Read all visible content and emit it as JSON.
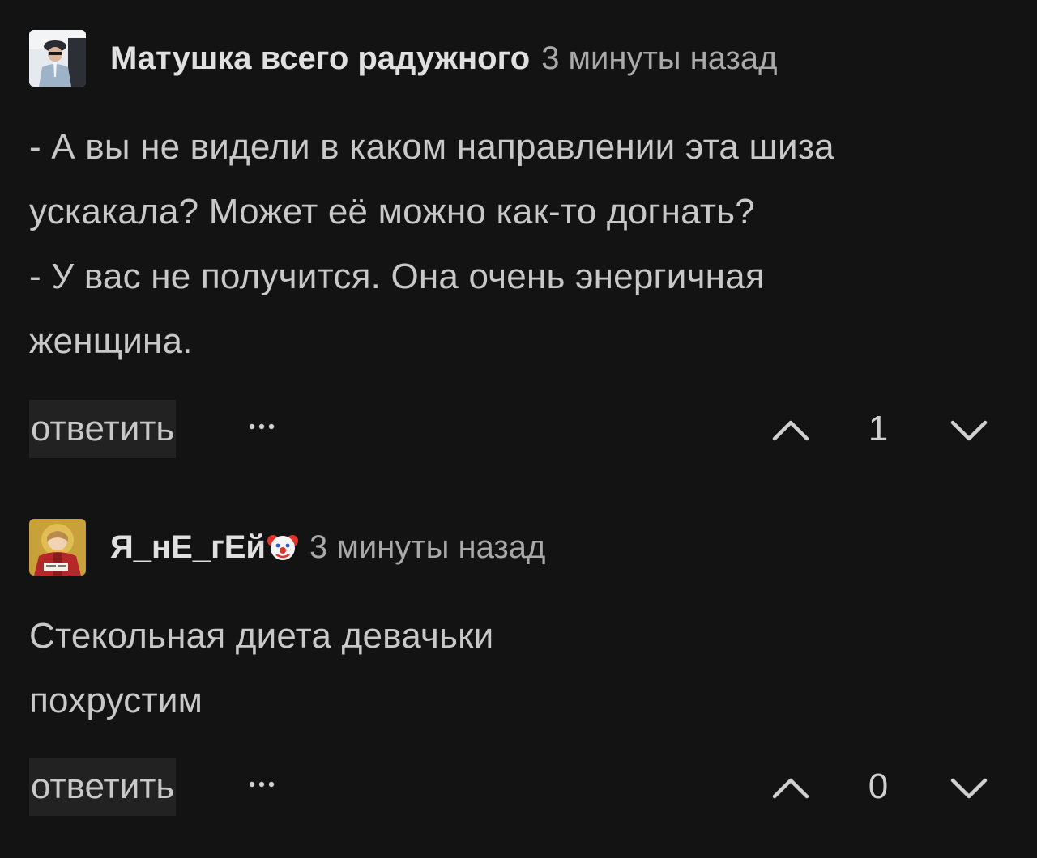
{
  "comments": [
    {
      "author": "Матушка всего радужного",
      "time": "3 минуты назад",
      "text": "- А вы не видели в каком направлении эта шиза\nускакала? Может её можно как-то догнать?\n- У вас не получится. Она очень энергичная\nженщина.",
      "reply_label": "ответить",
      "score": "1",
      "avatar_icon": "user-photo-avatar"
    },
    {
      "author": "Я_нЕ_гЕй",
      "author_badge_icon": "clown-face-emoji",
      "time": "3 минуты назад",
      "text": "Стекольная диета девачьки\nпохрустим",
      "reply_label": "ответить",
      "score": "0",
      "avatar_icon": "icon-image-avatar"
    }
  ],
  "icons": {
    "more": "more-dots-icon",
    "upvote": "chevron-up-icon",
    "downvote": "chevron-down-icon"
  },
  "colors": {
    "background": "#131313",
    "text": "#c8c8c8",
    "muted": "#a9a9a9",
    "reply_bg": "#222222"
  }
}
